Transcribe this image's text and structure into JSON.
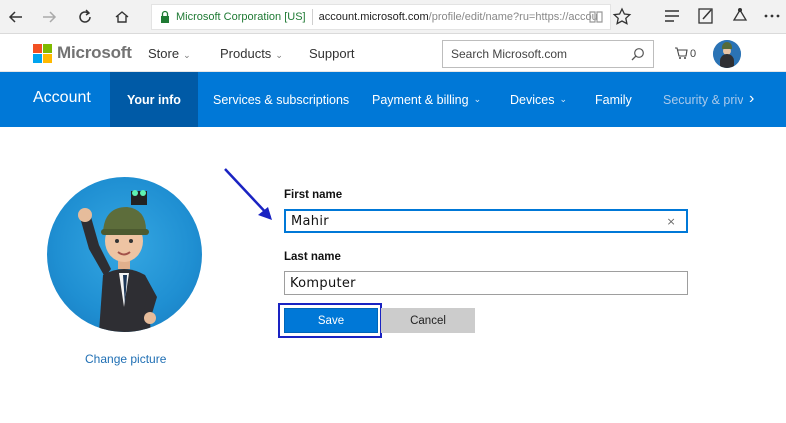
{
  "browser": {
    "site_identity": "Microsoft Corporation [US]",
    "url_domain": "account.microsoft.com",
    "url_path": "/profile/edit/name?ru=https://accou",
    "icons": [
      "back-icon",
      "forward-icon",
      "refresh-icon",
      "home-icon",
      "lock-icon",
      "reading-view-icon",
      "favorite-star-icon",
      "hub-icon",
      "notes-icon",
      "share-icon",
      "more-icon"
    ]
  },
  "header": {
    "brand": "Microsoft",
    "nav": [
      {
        "label": "Store",
        "chevron": "⌄"
      },
      {
        "label": "Products",
        "chevron": "⌄"
      },
      {
        "label": "Support"
      }
    ],
    "search_placeholder": "Search Microsoft.com",
    "cart_count": "0"
  },
  "account_bar": {
    "title": "Account",
    "tabs": [
      {
        "label": "Your info",
        "active": true
      },
      {
        "label": "Services & subscriptions"
      },
      {
        "label": "Payment & billing",
        "chevron": "⌄"
      },
      {
        "label": "Devices",
        "chevron": "⌄"
      },
      {
        "label": "Family"
      },
      {
        "label": "Security & priva",
        "faded": true
      }
    ],
    "more_glyph": "›"
  },
  "profile": {
    "change_picture": "Change picture"
  },
  "form": {
    "first_name_label": "First name",
    "first_name_value": "Mahir",
    "clear_glyph": "×",
    "last_name_label": "Last name",
    "last_name_value": "Komputer",
    "save_label": "Save",
    "cancel_label": "Cancel"
  },
  "colors": {
    "accent_blue": "#0078d7",
    "active_tab": "#005aa6",
    "annotation": "#1a23c2"
  }
}
